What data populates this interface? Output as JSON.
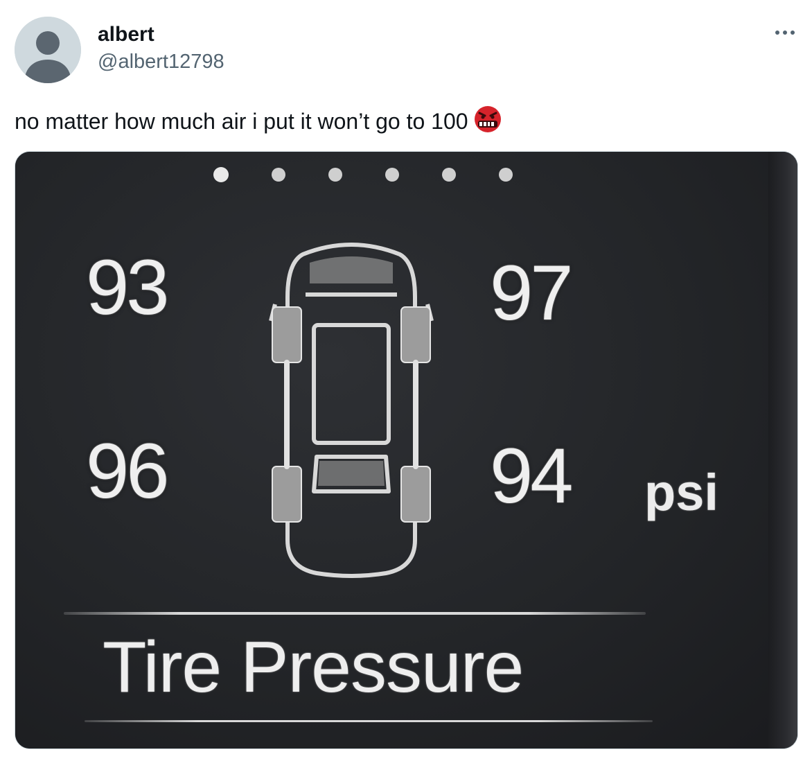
{
  "author": {
    "display_name": "albert",
    "handle": "@albert12798"
  },
  "tweet": {
    "text": "no matter how much air i put it won’t go to 100",
    "emoji": "face-with-symbols-on-mouth"
  },
  "media": {
    "tpms_screen": {
      "title": "Tire Pressure",
      "unit": "psi",
      "front_left": "93",
      "front_right": "97",
      "rear_left": "96",
      "rear_right": "94",
      "page_dots_count": 6
    }
  },
  "colors": {
    "text_primary": "#0f1419",
    "text_secondary": "#536471",
    "border": "#cfd9de",
    "emoji_red": "#d6232b"
  }
}
